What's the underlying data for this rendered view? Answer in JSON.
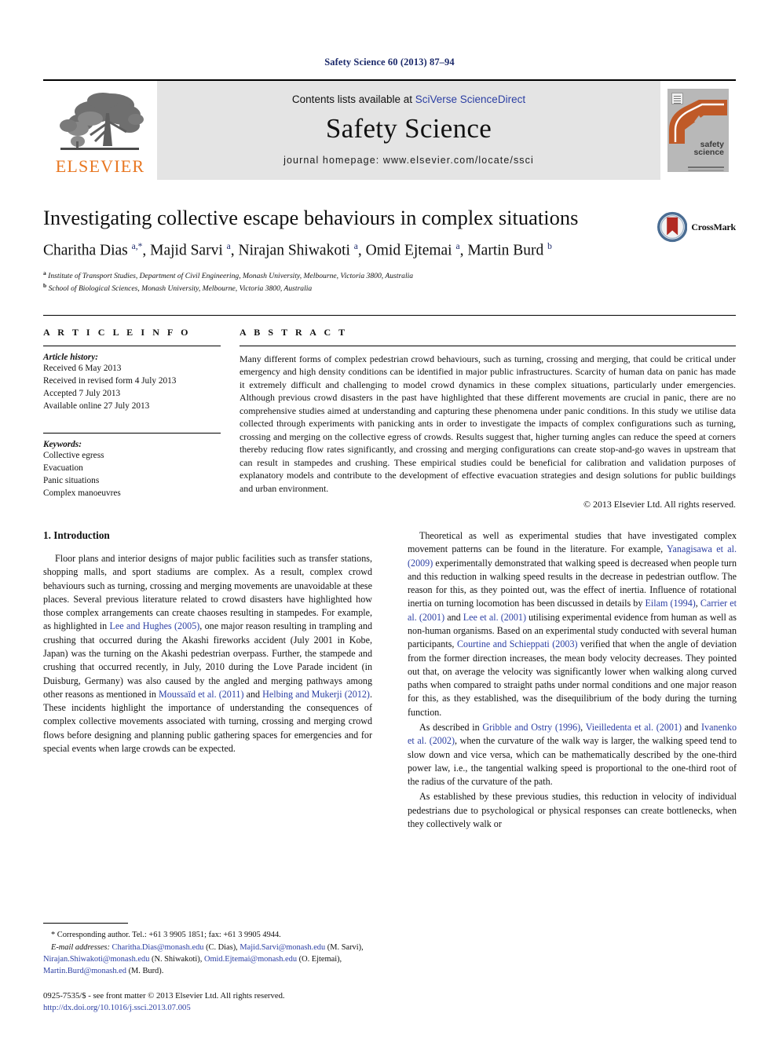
{
  "running_head": "Safety Science 60 (2013) 87–94",
  "masthead": {
    "contents_prefix": "Contents lists available at ",
    "contents_link": "SciVerse ScienceDirect",
    "journal_name": "Safety Science",
    "homepage": "journal homepage: www.elsevier.com/locate/ssci",
    "publisher_wordmark": "ELSEVIER",
    "cover_title_line1": "safety",
    "cover_title_line2": "science"
  },
  "article": {
    "title": "Investigating collective escape behaviours in complex situations",
    "authors_html": "Charitha Dias <sup>a,*</sup>, Majid Sarvi <sup>a</sup>, Nirajan Shiwakoti <sup>a</sup>, Omid Ejtemai <sup>a</sup>, Martin Burd <sup>b</sup>",
    "affiliation_a": "Institute of Transport Studies, Department of Civil Engineering, Monash University, Melbourne, Victoria 3800, Australia",
    "affiliation_b": "School of Biological Sciences, Monash University, Melbourne, Victoria 3800, Australia",
    "crossmark_label": "CrossMark"
  },
  "info": {
    "heading": "A R T I C L E  I N F O",
    "history_label": "Article history:",
    "history": [
      "Received 6 May 2013",
      "Received in revised form 4 July 2013",
      "Accepted 7 July 2013",
      "Available online 27 July 2013"
    ],
    "keywords_label": "Keywords:",
    "keywords": [
      "Collective egress",
      "Evacuation",
      "Panic situations",
      "Complex manoeuvres"
    ]
  },
  "abstract": {
    "heading": "A B S T R A C T",
    "text": "Many different forms of complex pedestrian crowd behaviours, such as turning, crossing and merging, that could be critical under emergency and high density conditions can be identified in major public infrastructures. Scarcity of human data on panic has made it extremely difficult and challenging to model crowd dynamics in these complex situations, particularly under emergencies. Although previous crowd disasters in the past have highlighted that these different movements are crucial in panic, there are no comprehensive studies aimed at understanding and capturing these phenomena under panic conditions. In this study we utilise data collected through experiments with panicking ants in order to investigate the impacts of complex configurations such as turning, crossing and merging on the collective egress of crowds. Results suggest that, higher turning angles can reduce the speed at corners thereby reducing flow rates significantly, and crossing and merging configurations can create stop-and-go waves in upstream that can result in stampedes and crushing. These empirical studies could be beneficial for calibration and validation purposes of explanatory models and contribute to the development of effective evacuation strategies and design solutions for public buildings and urban environment.",
    "copyright": "© 2013 Elsevier Ltd. All rights reserved."
  },
  "body": {
    "section_title": "1. Introduction",
    "left_paragraphs": [
      {
        "segments": [
          {
            "t": "Floor plans and interior designs of major public facilities such as transfer stations, shopping malls, and sport stadiums are complex. As a result, complex crowd behaviours such as turning, crossing and merging movements are unavoidable at these places. Several previous literature related to crowd disasters have highlighted how those complex arrangements can create chaoses resulting in stampedes. For example, as highlighted in ",
            "c": false
          },
          {
            "t": "Lee and Hughes (2005)",
            "c": true
          },
          {
            "t": ", one major reason resulting in trampling and crushing that occurred during the Akashi fireworks accident (July 2001 in Kobe, Japan) was the turning on the Akashi pedestrian overpass. Further, the stampede and crushing that occurred recently, in July, 2010 during the Love Parade incident (in Duisburg, Germany) was also caused by the angled and merging pathways among other reasons as mentioned in ",
            "c": false
          },
          {
            "t": "Moussaïd et al. (2011)",
            "c": true
          },
          {
            "t": " and ",
            "c": false
          },
          {
            "t": "Helbing and Mukerji (2012)",
            "c": true
          },
          {
            "t": ". These incidents highlight the importance of understanding the consequences of complex collective movements associated with turning, crossing and merging crowd flows before designing and planning public gathering spaces for emergencies and for special events when large crowds can be expected.",
            "c": false
          }
        ]
      }
    ],
    "right_paragraphs": [
      {
        "segments": [
          {
            "t": "Theoretical as well as experimental studies that have investigated complex movement patterns can be found in the literature. For example, ",
            "c": false
          },
          {
            "t": "Yanagisawa et al. (2009)",
            "c": true
          },
          {
            "t": " experimentally demonstrated that walking speed is decreased when people turn and this reduction in walking speed results in the decrease in pedestrian outflow. The reason for this, as they pointed out, was the effect of inertia. Influence of rotational inertia on turning locomotion has been discussed in details by ",
            "c": false
          },
          {
            "t": "Eilam (1994)",
            "c": true
          },
          {
            "t": ", ",
            "c": false
          },
          {
            "t": "Carrier et al. (2001)",
            "c": true
          },
          {
            "t": " and ",
            "c": false
          },
          {
            "t": "Lee et al. (2001)",
            "c": true
          },
          {
            "t": " utilising experimental evidence from human as well as non-human organisms. Based on an experimental study conducted with several human participants, ",
            "c": false
          },
          {
            "t": "Courtine and Schieppati (2003)",
            "c": true
          },
          {
            "t": " verified that when the angle of deviation from the former direction increases, the mean body velocity decreases. They pointed out that, on average the velocity was significantly lower when walking along curved paths when compared to straight paths under normal conditions and one major reason for this, as they established, was the disequilibrium of the body during the turning function.",
            "c": false
          }
        ]
      },
      {
        "segments": [
          {
            "t": "As described in ",
            "c": false
          },
          {
            "t": "Gribble and Ostry (1996)",
            "c": true
          },
          {
            "t": ", ",
            "c": false
          },
          {
            "t": "Vieilledenta et al. (2001)",
            "c": true
          },
          {
            "t": " and ",
            "c": false
          },
          {
            "t": "Ivanenko et al. (2002)",
            "c": true
          },
          {
            "t": ", when the curvature of the walk way is larger, the walking speed tend to slow down and vice versa, which can be mathematically described by the one-third power law, i.e., the tangential walking speed is proportional to the one-third root of the radius of the curvature of the path.",
            "c": false
          }
        ]
      },
      {
        "segments": [
          {
            "t": "As established by these previous studies, this reduction in velocity of individual pedestrians due to psychological or physical responses can create bottlenecks, when they collectively walk or",
            "c": false
          }
        ]
      }
    ]
  },
  "footer": {
    "corresponding": "* Corresponding author. Tel.: +61 3 9905 1851; fax: +61 3 9905 4944.",
    "emails_label": "E-mail addresses:",
    "email_segments": [
      {
        "t": "Charitha.Dias@monash.edu",
        "c": true
      },
      {
        "t": " (C. Dias), ",
        "c": false
      },
      {
        "t": "Majid.Sarvi@monash.edu",
        "c": true
      },
      {
        "t": " (M. Sarvi), ",
        "c": false
      },
      {
        "t": "Nirajan.Shiwakoti@monash.edu",
        "c": true
      },
      {
        "t": " (N. Shiwakoti), ",
        "c": false
      },
      {
        "t": "Omid.Ejtemai@monash.edu",
        "c": true
      },
      {
        "t": " (O. Ejtemai), ",
        "c": false
      },
      {
        "t": "Martin.Burd@monash.ed",
        "c": true
      },
      {
        "t": " (M. Burd).",
        "c": false
      }
    ],
    "issn_line": "0925-7535/$ - see front matter © 2013 Elsevier Ltd. All rights reserved.",
    "doi_line": "http://dx.doi.org/10.1016/j.ssci.2013.07.005"
  },
  "colors": {
    "link_blue": "#2c3fa3",
    "header_navy": "#1c2a6b",
    "elsevier_orange": "#E87722",
    "masthead_gray": "#e4e4e4",
    "cover_rust": "#bf5a28"
  }
}
